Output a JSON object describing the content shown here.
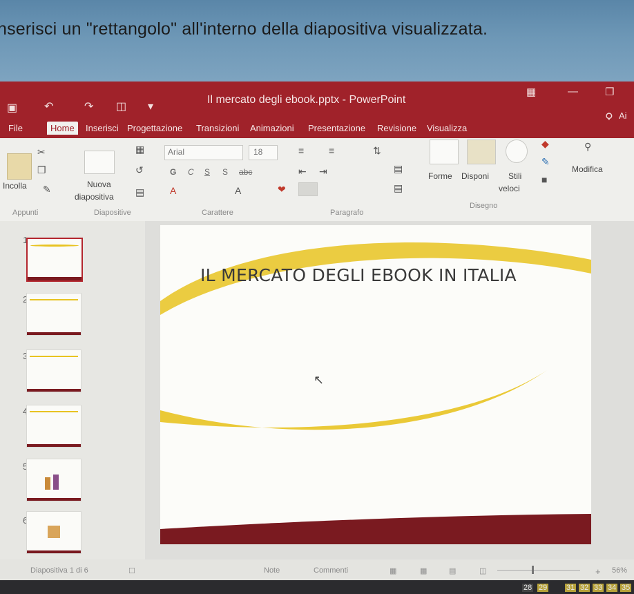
{
  "instruction": "nserisci un \"rettangolo\" all'interno della diapositiva visualizzata.",
  "window": {
    "title": "Il mercato degli ebook.pptx - PowerPoint",
    "tell_me": "Ai"
  },
  "tabs": [
    "File",
    "Home",
    "Inserisci",
    "Progettazione",
    "Transizioni",
    "Animazioni",
    "Presentazione",
    "Revisione",
    "Visualizza"
  ],
  "ribbon": {
    "paste_label": "Incolla",
    "new_slide_label_1": "Nuova",
    "new_slide_label_2": "diapositiva",
    "font_name": "Arial",
    "font_size": "18",
    "bold": "G",
    "italic": "C",
    "underline": "S",
    "shadow": "S",
    "strike": "abc",
    "shapes_label": "Forme",
    "arrange_label": "Disponi",
    "quick_styles_label_1": "Stili",
    "quick_styles_label_2": "veloci",
    "editing_label": "Modifica",
    "groups": {
      "clipboard": "Appunti",
      "slides": "Diapositive",
      "font": "Carattere",
      "paragraph": "Paragrafo",
      "drawing": "Disegno"
    }
  },
  "thumbnails": [
    "1",
    "2",
    "3",
    "4",
    "5",
    "6"
  ],
  "slide": {
    "title": "IL MERCATO DEGLI EBOOK IN ITALIA"
  },
  "status": {
    "slide_indicator": "Diapositiva 1 di 6",
    "notes": "Note",
    "comments": "Commenti",
    "zoom": "56%"
  },
  "taskbar": [
    "28",
    "29",
    "31",
    "32",
    "33",
    "34",
    "35"
  ],
  "colors": {
    "accent": "#a0222a",
    "slide_gold": "#e8c321",
    "slide_dark_red": "#7a1a20"
  }
}
